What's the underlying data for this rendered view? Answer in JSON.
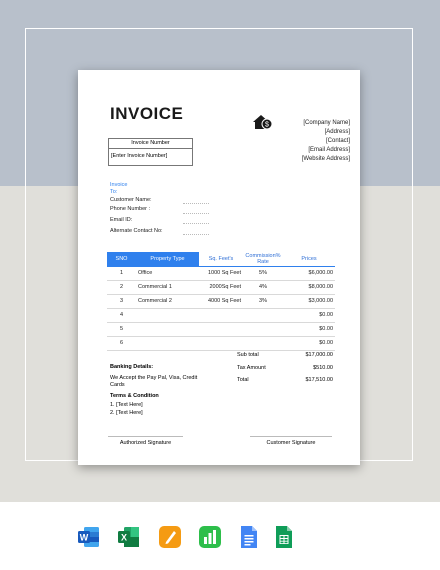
{
  "document": {
    "title": "INVOICE",
    "company": {
      "name": "[Company Name]",
      "address": "[Address]",
      "contact": "[Contact]",
      "email": "[Email Address]",
      "website": "[Website Address]"
    },
    "invoice_number": {
      "label": "Invoice Number",
      "value": "[Enter Invoice Number]"
    },
    "invoice_to": {
      "label_line1": "Invoice",
      "label_line2": "To:",
      "fields": [
        "Customer Name:",
        "Phone Number :",
        "Email ID:",
        "Alternate Contact No:"
      ]
    },
    "table": {
      "headers": [
        "SNO",
        "Property Type",
        "Sq. Feet's",
        "Commission% Rate",
        "Prices"
      ],
      "rows": [
        {
          "sno": "1",
          "type": "Office",
          "sqft": "1000 Sq Feet",
          "rate": "5%",
          "price": "$6,000.00"
        },
        {
          "sno": "2",
          "type": "Commercial 1",
          "sqft": "2000Sq Feet",
          "rate": "4%",
          "price": "$8,000.00"
        },
        {
          "sno": "3",
          "type": "Commercial 2",
          "sqft": "4000 Sq Feet",
          "rate": "3%",
          "price": "$3,000.00"
        },
        {
          "sno": "4",
          "type": "",
          "sqft": "",
          "rate": "",
          "price": "$0.00"
        },
        {
          "sno": "5",
          "type": "",
          "sqft": "",
          "rate": "",
          "price": "$0.00"
        },
        {
          "sno": "6",
          "type": "",
          "sqft": "",
          "rate": "",
          "price": "$0.00"
        }
      ]
    },
    "totals": {
      "subtotal_label": "Sub total",
      "subtotal_value": "$17,000.00",
      "tax_label": "Tax Amount",
      "tax_value": "$510.00",
      "total_label": "Total",
      "total_value": "$17,510.00"
    },
    "banking": {
      "heading": "Banking Details:",
      "text": "We Accept the  Pay Pal, Visa, Credit Cards"
    },
    "terms": {
      "heading": "Terms & Condition",
      "items": [
        "1. [Text Here]",
        "2. [Text Here]"
      ]
    },
    "signatures": {
      "authorized": "Authorized  Signature",
      "customer": "Customer Signature"
    }
  },
  "format_icons": [
    "word-icon",
    "excel-icon",
    "pages-icon",
    "numbers-icon",
    "google-docs-icon",
    "google-sheets-icon"
  ],
  "colors": {
    "accent": "#2f80ed",
    "background_top": "#b8c0cb",
    "background_bottom": "#e0dfda"
  }
}
